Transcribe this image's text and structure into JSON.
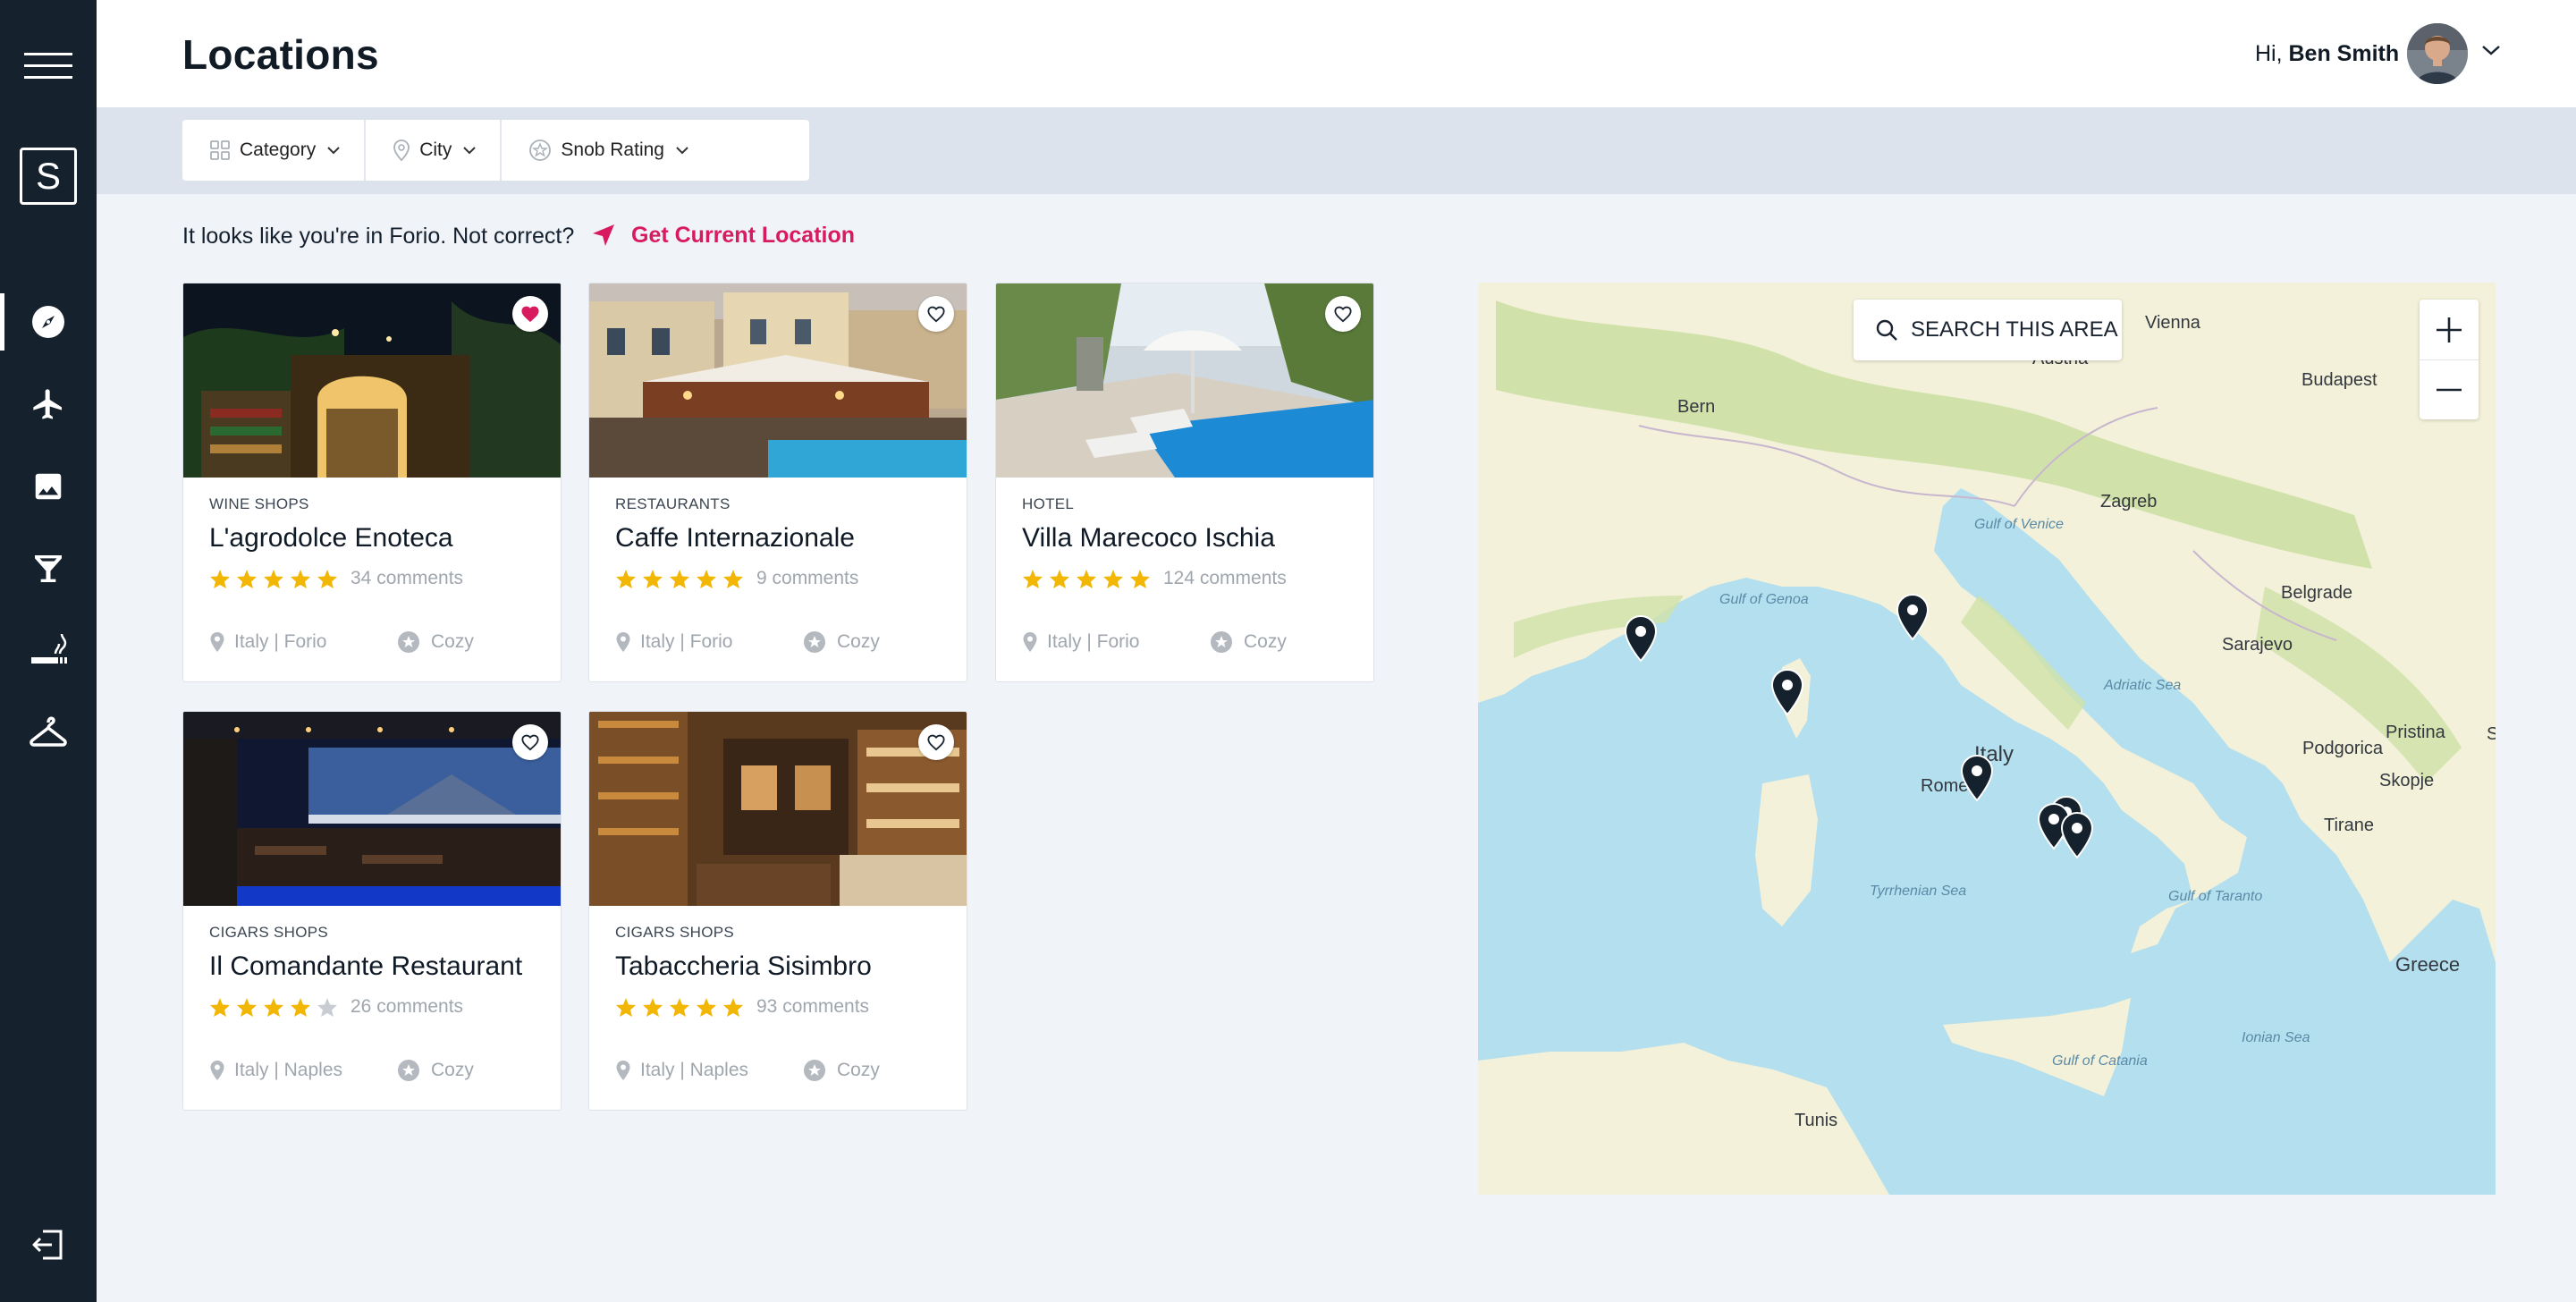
{
  "header": {
    "title": "Locations",
    "greeting_prefix": "Hi, ",
    "user_name": "Ben Smith"
  },
  "sidebar": {
    "logo_letter": "S",
    "items": [
      {
        "icon": "compass-icon",
        "active": true
      },
      {
        "icon": "airplane-icon",
        "active": false
      },
      {
        "icon": "image-icon",
        "active": false
      },
      {
        "icon": "cocktail-glass-icon",
        "active": false
      },
      {
        "icon": "cigar-icon",
        "active": false
      },
      {
        "icon": "hanger-icon",
        "active": false
      }
    ],
    "logout_icon": "logout-icon"
  },
  "filters": [
    {
      "icon": "grid-icon",
      "label": "Category"
    },
    {
      "icon": "map-pin-icon",
      "label": "City"
    },
    {
      "icon": "badge-icon",
      "label": "Snob Rating"
    }
  ],
  "location_bar": {
    "text": "It looks like you're in Forio. Not correct?",
    "link": "Get Current Location"
  },
  "cards": [
    {
      "category": "WINE SHOPS",
      "name": "L'agrodolce Enoteca",
      "rating": 5,
      "comments": "34 comments",
      "place": "Italy | Forio",
      "tag": "Cozy",
      "favorited": true
    },
    {
      "category": "RESTAURANTS",
      "name": "Caffe Internazionale",
      "rating": 5,
      "comments": "9 comments",
      "place": "Italy | Forio",
      "tag": "Cozy",
      "favorited": false
    },
    {
      "category": "HOTEL",
      "name": "Villa Marecoco Ischia",
      "rating": 5,
      "comments": "124 comments",
      "place": "Italy | Forio",
      "tag": "Cozy",
      "favorited": false
    },
    {
      "category": "CIGARS SHOPS",
      "name": "Il Comandante Restaurant",
      "rating": 4,
      "comments": "26 comments",
      "place": "Italy | Naples",
      "tag": "Cozy",
      "favorited": false
    },
    {
      "category": "CIGARS SHOPS",
      "name": "Tabaccheria Sisimbro",
      "rating": 5,
      "comments": "93 comments",
      "place": "Italy | Naples",
      "tag": "Cozy",
      "favorited": false
    }
  ],
  "map": {
    "search_label": "SEARCH THIS AREA",
    "zoom_in": "+",
    "zoom_out": "−",
    "cities": [
      "Vienna",
      "Budapest",
      "Bern",
      "Austria",
      "Zagreb",
      "Belgrade",
      "Sarajevo",
      "Podgorica",
      "Pristina",
      "Skopje",
      "Tirane",
      "Rome",
      "Italy",
      "Greece",
      "Tunis",
      "S"
    ],
    "seas": [
      "Gulf of Venice",
      "Gulf of Genoa",
      "Adriatic Sea",
      "Tyrrhenian Sea",
      "Gulf of Taranto",
      "Ionian Sea",
      "Gulf of Catania"
    ]
  },
  "colors": {
    "sidebar": "#16212e",
    "accent": "#d81b5e",
    "star": "#f2b705",
    "star_empty": "#c9cdd3",
    "water": "#b3dfee",
    "land": "#f3f1d9"
  }
}
